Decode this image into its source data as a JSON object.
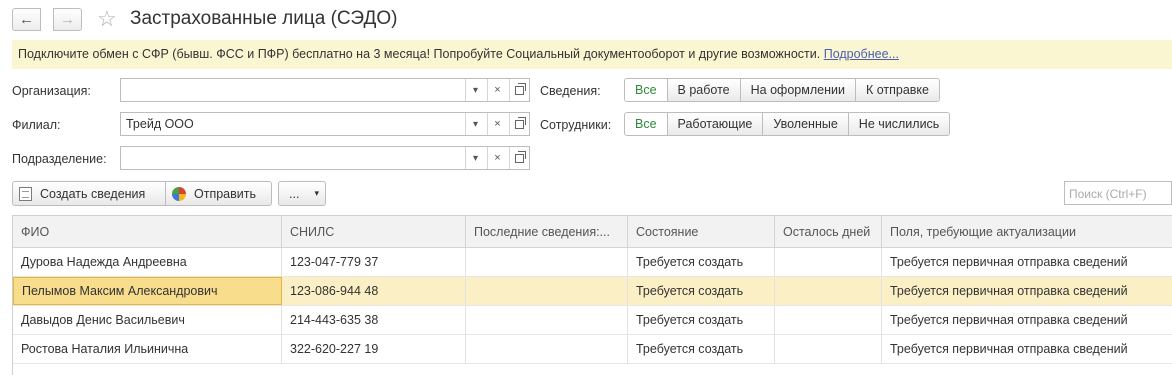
{
  "window": {
    "title": "Застрахованные лица (СЭДО)"
  },
  "banner": {
    "text": "Подключите обмен с СФР (бывш. ФСС и ПФР) бесплатно на 3 месяца! Попробуйте Социальный документооборот и другие возможности.",
    "link": "Подробнее..."
  },
  "filters": {
    "organization": {
      "label": "Организация:",
      "value": ""
    },
    "branch": {
      "label": "Филиал:",
      "value": "Трейд ООО"
    },
    "department": {
      "label": "Подразделение:",
      "value": ""
    }
  },
  "info_group": {
    "label": "Сведения:",
    "options": [
      "Все",
      "В работе",
      "На оформлении",
      "К отправке"
    ],
    "selected": "Все"
  },
  "employees_group": {
    "label": "Сотрудники:",
    "options": [
      "Все",
      "Работающие",
      "Уволенные",
      "Не числились"
    ],
    "selected": "Все"
  },
  "toolbar": {
    "create": "Создать сведения",
    "send": "Отправить",
    "more": "...",
    "search_placeholder": "Поиск (Ctrl+F)"
  },
  "table": {
    "columns": [
      "ФИО",
      "СНИЛС",
      "Последние сведения:...",
      "Состояние",
      "Осталось дней",
      "Поля, требующие актуализации"
    ],
    "rows": [
      {
        "name": "Дурова Надежда Андреевна",
        "snils": "123-047-779 37",
        "last": "",
        "state": "Требуется создать",
        "days": "",
        "fields": "Требуется первичная отправка сведений"
      },
      {
        "name": "Пелымов Максим Александрович",
        "snils": "123-086-944 48",
        "last": "",
        "state": "Требуется создать",
        "days": "",
        "fields": "Требуется первичная отправка сведений"
      },
      {
        "name": "Давыдов Денис Васильевич",
        "snils": "214-443-635 38",
        "last": "",
        "state": "Требуется создать",
        "days": "",
        "fields": "Требуется первичная отправка сведений"
      },
      {
        "name": "Ростова Наталия Ильинична",
        "snils": "322-620-227 19",
        "last": "",
        "state": "Требуется создать",
        "days": "",
        "fields": "Требуется первичная отправка сведений"
      }
    ],
    "selected_row": 1
  },
  "colors": {
    "active_segment_text": "#2d8a3a",
    "banner_bg": "#fbf6d2",
    "selected_row_bg": "#fbf0c5",
    "link": "#4b5fae"
  }
}
